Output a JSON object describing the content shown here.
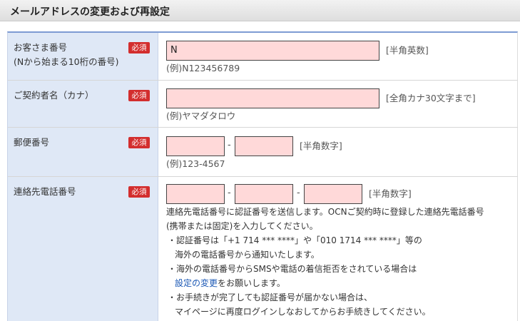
{
  "header": {
    "title": "メールアドレスの変更および再設定"
  },
  "required_label": "必須",
  "rows": {
    "customer_no": {
      "label1": "お客さま番号",
      "label2": "(Nから始まる10桁の番号)",
      "value": "N",
      "hint": "[半角英数]",
      "example": "(例)N123456789"
    },
    "contractor": {
      "label": "ご契約者名（カナ）",
      "value": "",
      "hint": "[全角カナ30文字まで]",
      "example": "(例)ヤマダタロウ"
    },
    "postal": {
      "label": "郵便番号",
      "sep": "-",
      "hint": "[半角数字]",
      "example": "(例)123-4567"
    },
    "phone": {
      "label": "連絡先電話番号",
      "sep": "-",
      "hint": "[半角数字]",
      "notes": [
        "連絡先電話番号に認証番号を送信します。OCNご契約時に登録した連絡先電話番号",
        "(携帯または固定)を入力してください。",
        "・認証番号は「+1 714 *** ****」や「010 1714 *** ****」等の",
        "海外の電話番号から通知いたします。",
        "・海外の電話番号からSMSや電話の着信拒否をされている場合は",
        "設定の変更",
        "をお願いします。",
        "・お手続きが完了しても認証番号が届かない場合は、",
        "マイページに再度ログインしなおしてからお手続きしてください。"
      ]
    }
  }
}
